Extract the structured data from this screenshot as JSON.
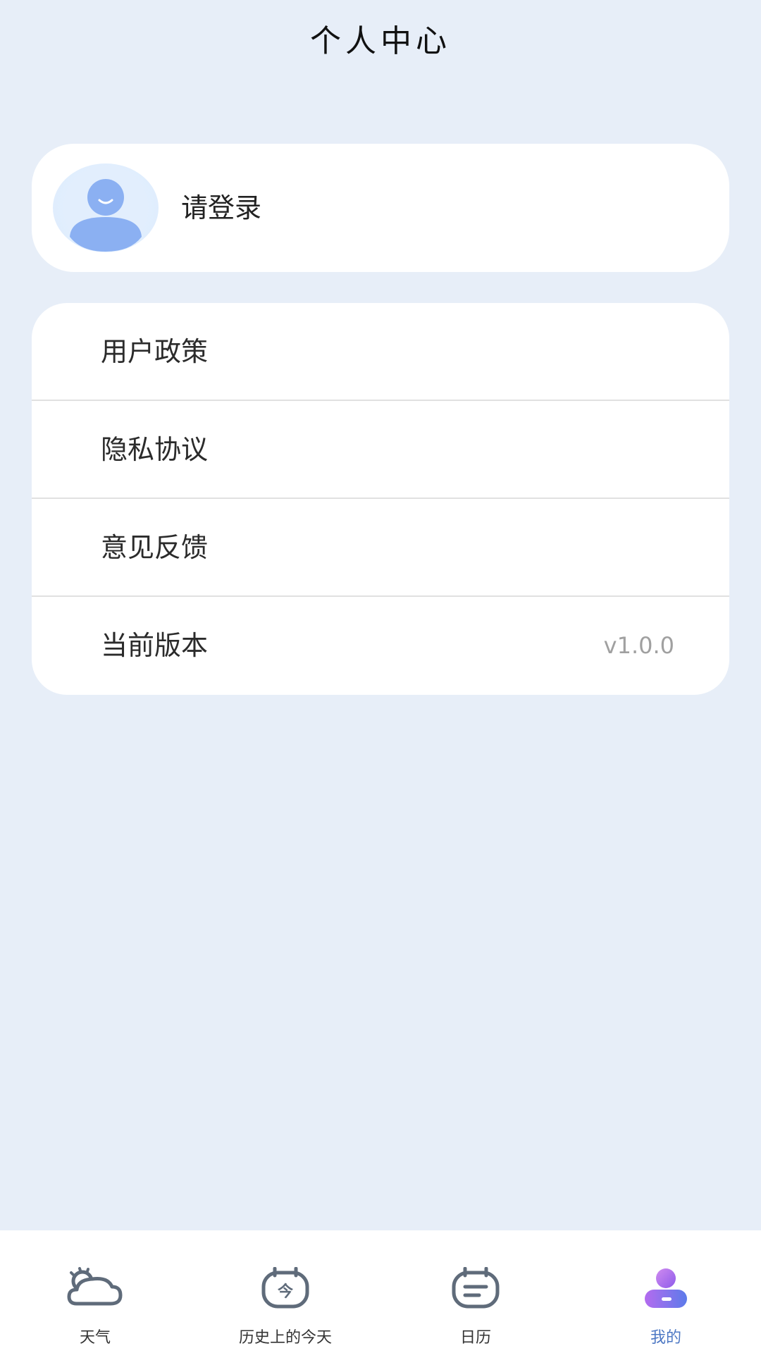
{
  "header": {
    "title": "个人中心"
  },
  "login": {
    "prompt": "请登录"
  },
  "menu": [
    {
      "label": "用户政策",
      "value": ""
    },
    {
      "label": "隐私协议",
      "value": ""
    },
    {
      "label": "意见反馈",
      "value": ""
    },
    {
      "label": "当前版本",
      "value": "v1.0.0"
    }
  ],
  "tabbar": {
    "items": [
      {
        "label": "天气",
        "icon": "weather-cloud-icon",
        "active": false
      },
      {
        "label": "历史上的今天",
        "icon": "today-calendar-icon",
        "active": false
      },
      {
        "label": "日历",
        "icon": "calendar-icon",
        "active": false
      },
      {
        "label": "我的",
        "icon": "profile-icon",
        "active": true
      }
    ],
    "active_color": "#4D78C4",
    "inactive_color": "#333333"
  }
}
